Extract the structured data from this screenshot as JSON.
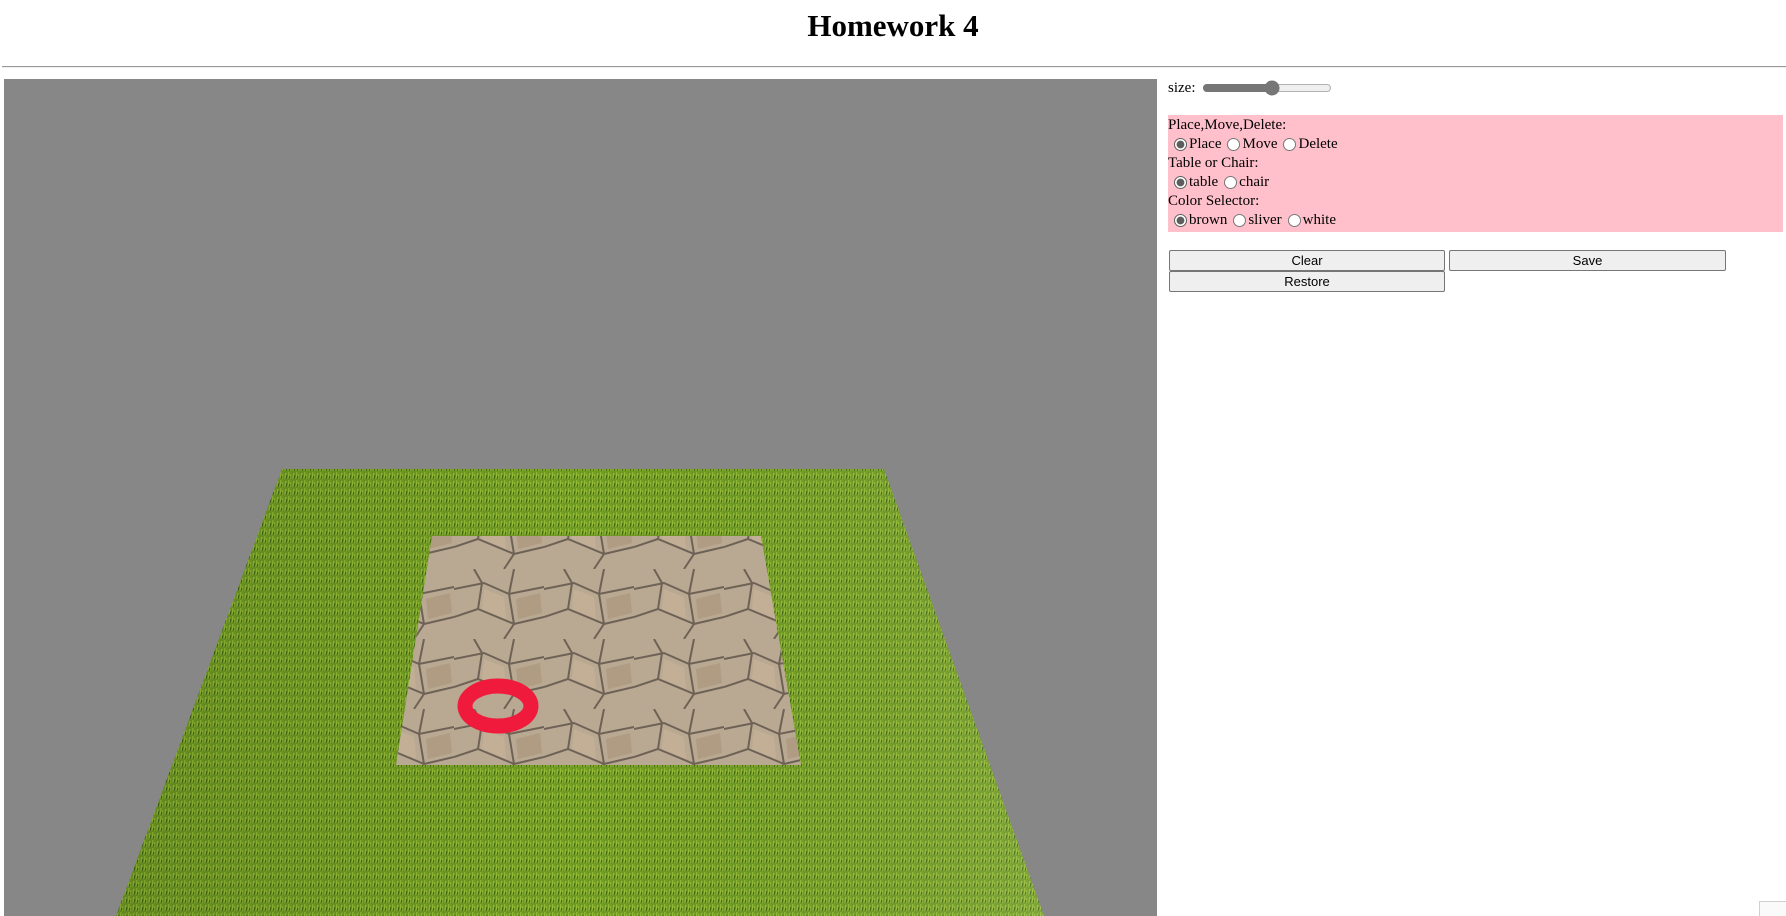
{
  "header": {
    "title": "Homework 4"
  },
  "scene": {
    "background": "#888787",
    "grass_color": "#6f9a22",
    "stone_color": "#b7a58f",
    "marker_color": "#f01a3c"
  },
  "controls": {
    "size_label": "size:",
    "size_value": 55,
    "mode": {
      "label": "Place,Move,Delete:",
      "options": [
        "Place",
        "Move",
        "Delete"
      ],
      "selected": "Place"
    },
    "object": {
      "label": "Table or Chair:",
      "options": [
        "table",
        "chair"
      ],
      "selected": "table"
    },
    "color": {
      "label": "Color Selector:",
      "options": [
        "brown",
        "sliver",
        "white"
      ],
      "selected": "brown"
    },
    "panel_color": "#ffc0cb"
  },
  "buttons": {
    "clear": "Clear",
    "save": "Save",
    "restore": "Restore"
  }
}
